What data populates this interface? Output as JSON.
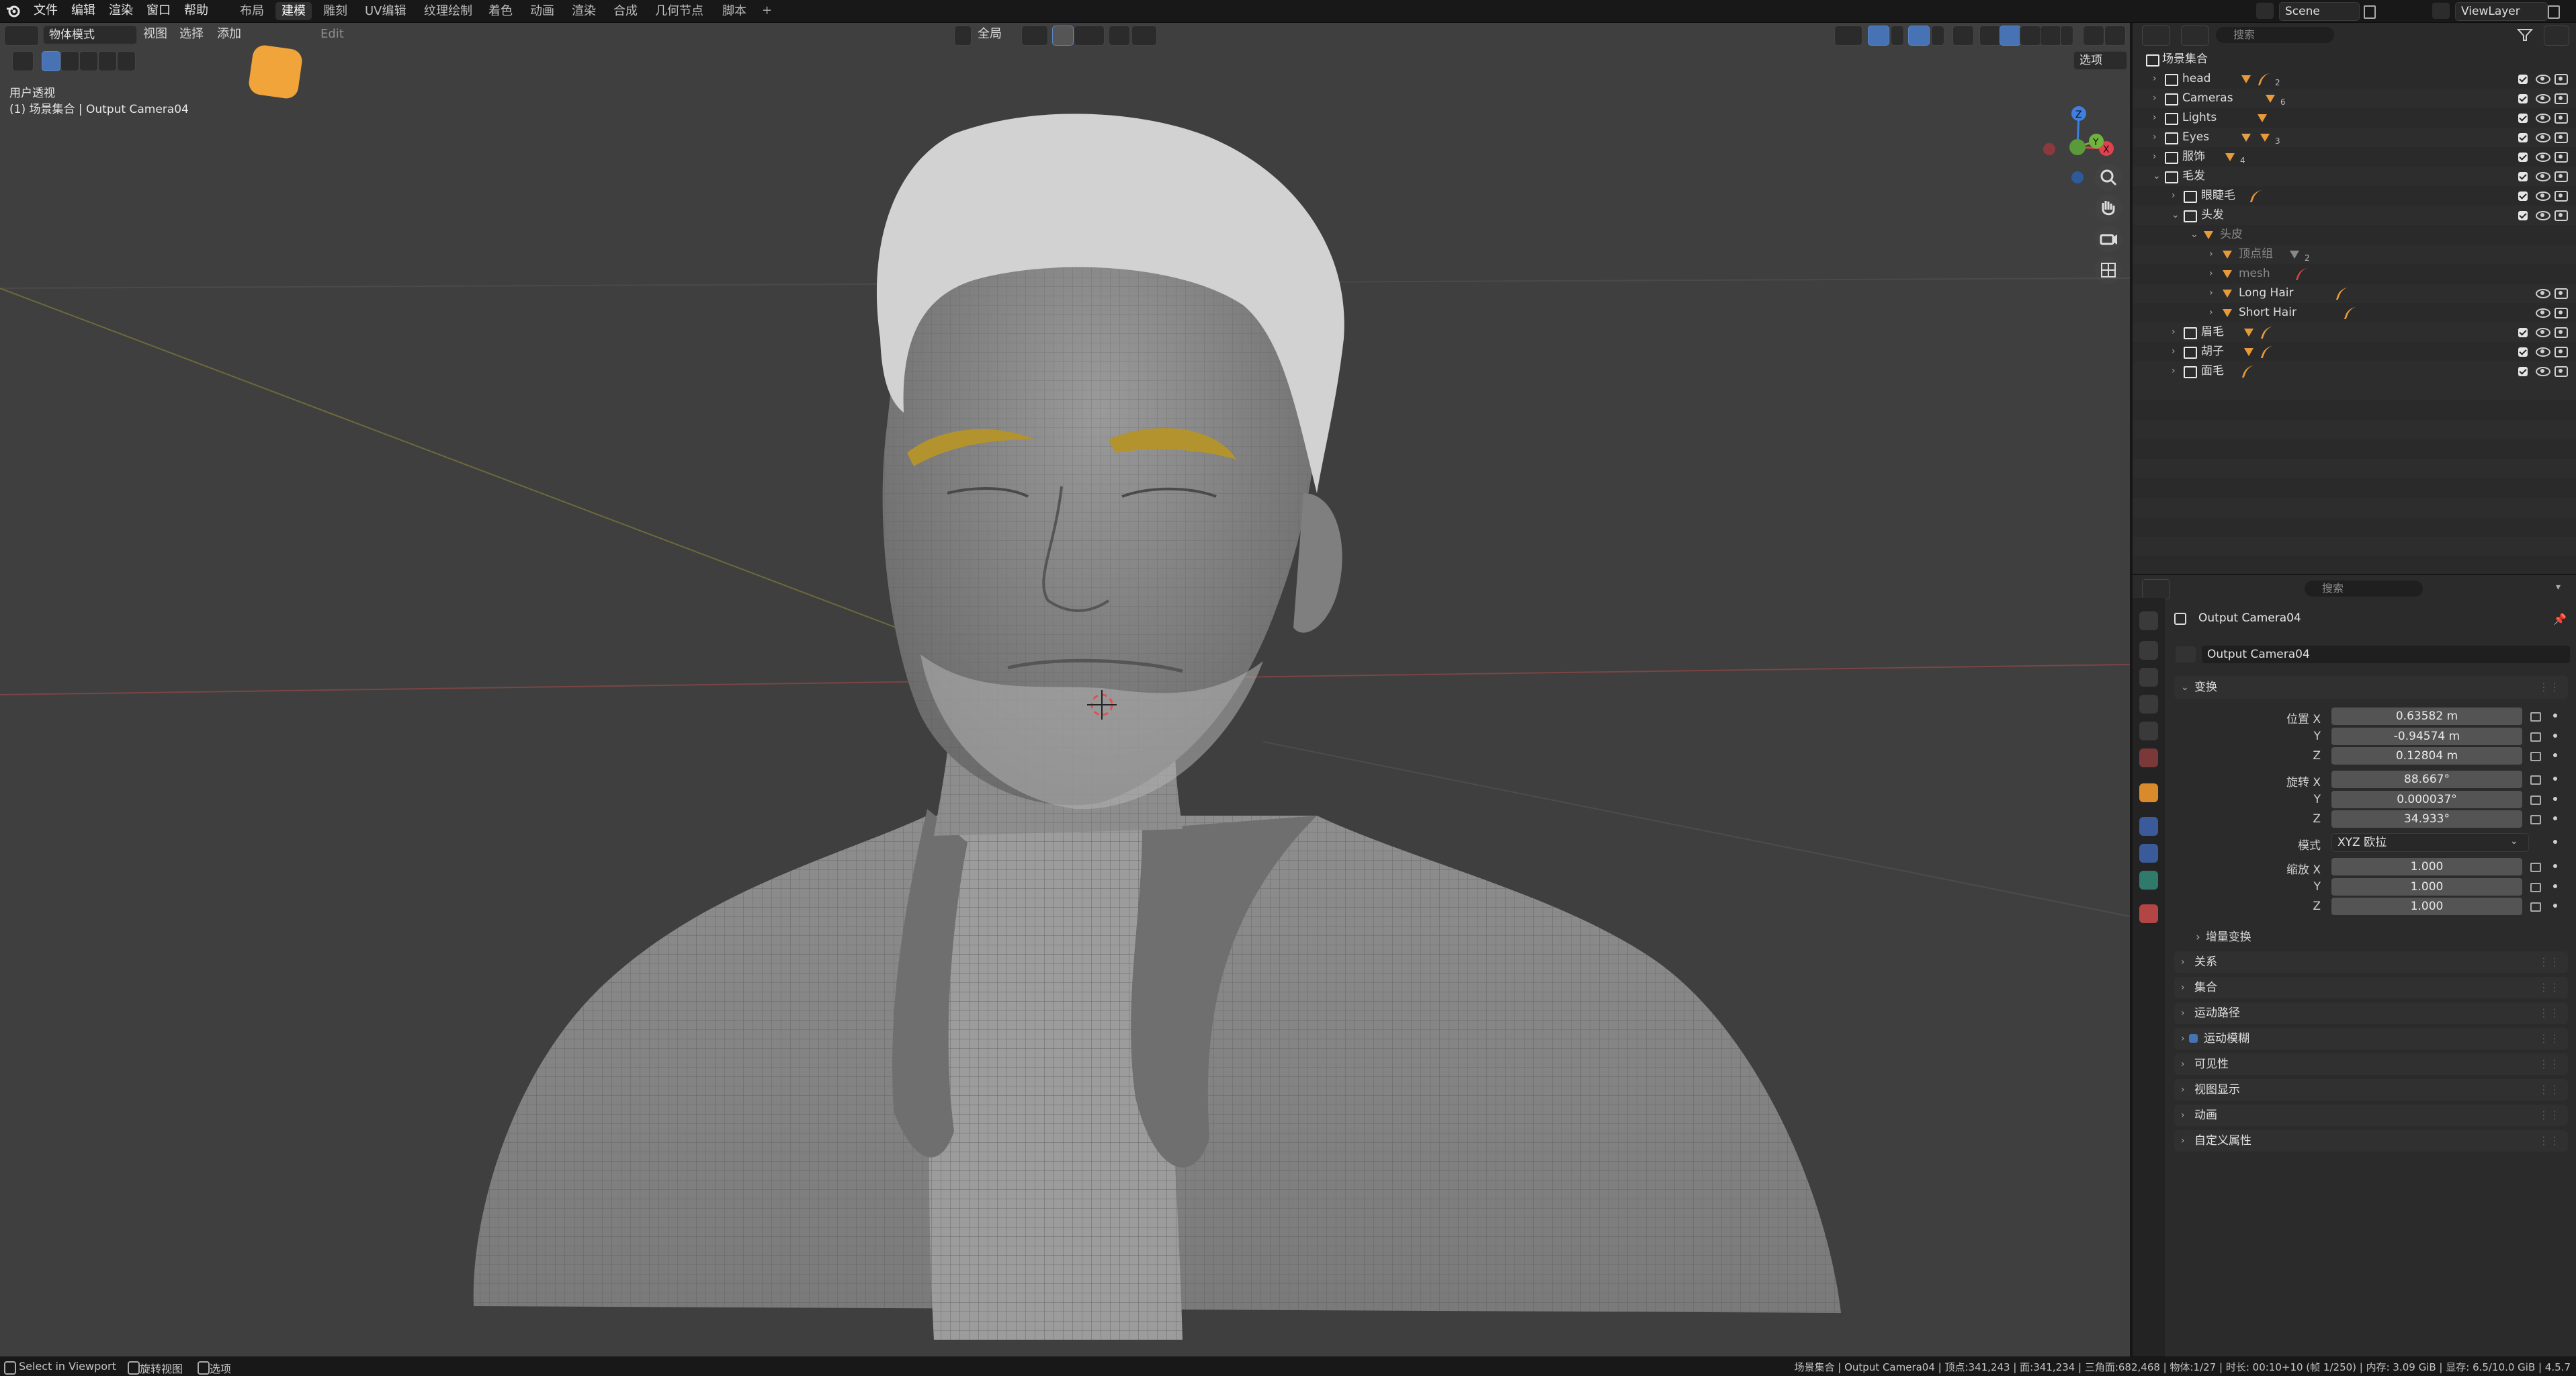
{
  "top_menu": [
    "文件",
    "编辑",
    "渲染",
    "窗口",
    "帮助"
  ],
  "workspace_tabs": [
    "布局",
    "建模",
    "雕刻",
    "UV编辑",
    "纹理绘制",
    "着色",
    "动画",
    "渲染",
    "合成",
    "几何节点",
    "脚本"
  ],
  "active_workspace": "建模",
  "scene_name": "Scene",
  "view_layer_name": "ViewLayer",
  "viewport": {
    "mode": "物体模式",
    "menus": [
      "视图",
      "选择",
      "添加"
    ],
    "edit_label": "Edit",
    "transform_orientation": "全局",
    "options_label": "选项",
    "view_name": "用户透视",
    "view_context": "(1) 场景集合 | Output Camera04"
  },
  "outliner": {
    "search_placeholder": "搜索",
    "root": "场景集合",
    "rows": [
      {
        "label": "head",
        "level": 1,
        "icons": [
          "mesh",
          "hair"
        ],
        "count": "2"
      },
      {
        "label": "Cameras",
        "level": 1,
        "icons": [
          "camera"
        ],
        "count": "6"
      },
      {
        "label": "Lights",
        "level": 1,
        "icons": [
          "light"
        ],
        "count": ""
      },
      {
        "label": "Eyes",
        "level": 1,
        "icons": [
          "empty",
          "mesh"
        ],
        "count": "3"
      },
      {
        "label": "服饰",
        "level": 1,
        "icons": [
          "mesh"
        ],
        "count": "4"
      },
      {
        "label": "毛发",
        "level": 1,
        "icons": [],
        "count": ""
      },
      {
        "label": "眼睫毛",
        "level": 2,
        "icons": [
          "hair"
        ],
        "count": ""
      },
      {
        "label": "头发",
        "level": 2,
        "icons": [],
        "count": ""
      },
      {
        "label": "头皮",
        "level": 3,
        "icons": [],
        "count": ""
      },
      {
        "label": "顶点组",
        "level": 4,
        "icons": [
          "group"
        ],
        "count": "2"
      },
      {
        "label": "mesh",
        "level": 4,
        "icons": [
          "modifier"
        ],
        "count": ""
      },
      {
        "label": "Long Hair",
        "level": 4,
        "icons": [
          "hair"
        ],
        "count": ""
      },
      {
        "label": "Short Hair",
        "level": 4,
        "icons": [
          "hair"
        ],
        "count": ""
      },
      {
        "label": "眉毛",
        "level": 2,
        "icons": [
          "mesh",
          "hair"
        ],
        "count": ""
      },
      {
        "label": "胡子",
        "level": 2,
        "icons": [
          "mesh",
          "hair"
        ],
        "count": ""
      },
      {
        "label": "面毛",
        "level": 2,
        "icons": [
          "hair"
        ],
        "count": ""
      }
    ]
  },
  "properties": {
    "search_placeholder": "搜索",
    "context_title": "Output Camera04",
    "object_name": "Output Camera04",
    "transform_title": "变换",
    "location_label": "位置 X",
    "location": [
      "0.63582 m",
      "-0.94574 m",
      "0.12804 m"
    ],
    "rotation_label": "旋转 X",
    "rotation": [
      "88.667°",
      "0.000037°",
      "34.933°"
    ],
    "mode_label": "模式",
    "rotation_mode": "XYZ 欧拉",
    "scale_label": "缩放 X",
    "scale": [
      "1.000",
      "1.000",
      "1.000"
    ],
    "axis_y": "Y",
    "axis_z": "Z",
    "delta_transform": "增量变换",
    "panels": [
      "关系",
      "集合",
      "运动路径",
      "运动模糊",
      "可见性",
      "视图显示",
      "动画",
      "自定义属性"
    ]
  },
  "statusbar": {
    "left": [
      "Select in Viewport",
      "旋转视图",
      "选项"
    ],
    "right": "场景集合 | Output Camera04 | 顶点:341,243 | 面:341,234 | 三角面:682,468 | 物体:1/27 | 时长: 00:10+10 (帧 1/250) | 内存: 3.09 GiB | 显存: 6.5/10.0 GiB | 4.5.7"
  },
  "colors": {
    "accent_blue": "#4772b3",
    "orange": "#e79a3a",
    "viewport_bg": "#3f3f3f",
    "axis_x": "#e0424d",
    "axis_y": "#6fb43c",
    "axis_z": "#3e7fe0"
  }
}
